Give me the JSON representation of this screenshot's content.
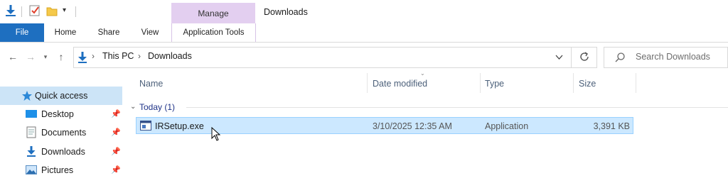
{
  "window": {
    "title": "Downloads"
  },
  "contextual_tab": {
    "group_label": "Manage",
    "tab_label": "Application Tools"
  },
  "ribbon": {
    "tabs": [
      "File",
      "Home",
      "Share",
      "View"
    ]
  },
  "address": {
    "crumbs": [
      "This PC",
      "Downloads"
    ],
    "search_placeholder": "Search Downloads"
  },
  "nav_pane": {
    "quick_access": "Quick access",
    "items": [
      {
        "label": "Desktop",
        "icon": "desktop-icon"
      },
      {
        "label": "Documents",
        "icon": "documents-icon"
      },
      {
        "label": "Downloads",
        "icon": "downloads-icon"
      },
      {
        "label": "Pictures",
        "icon": "pictures-icon"
      }
    ]
  },
  "columns": {
    "name": "Name",
    "date": "Date modified",
    "type": "Type",
    "size": "Size"
  },
  "groups": [
    {
      "label": "Today (1)",
      "files": [
        {
          "name": "IRSetup.exe",
          "date": "3/10/2025 12:35 AM",
          "type": "Application",
          "size": "3,391 KB",
          "selected": true
        }
      ]
    }
  ],
  "colors": {
    "file_tab": "#1e6fc0",
    "manage_tab": "#e3cff0",
    "selection": "#cce8ff",
    "group_heading": "#1e3287"
  }
}
